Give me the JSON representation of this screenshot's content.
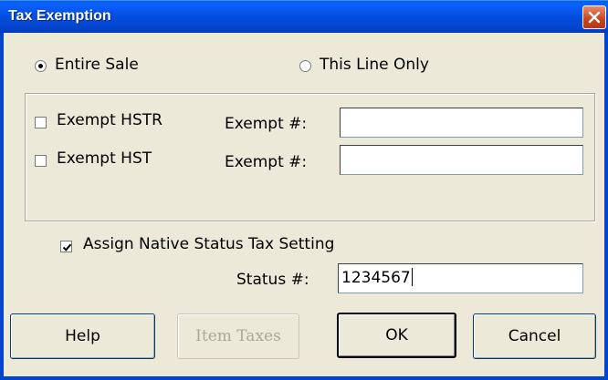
{
  "window": {
    "title": "Tax Exemption"
  },
  "scope": {
    "options": [
      {
        "label": "Entire Sale",
        "selected": true
      },
      {
        "label": "This Line Only",
        "selected": false
      }
    ]
  },
  "exemptions": [
    {
      "label": "Exempt HSTR",
      "checked": false,
      "number_label": "Exempt #:",
      "value": ""
    },
    {
      "label": "Exempt HST",
      "checked": false,
      "number_label": "Exempt #:",
      "value": ""
    }
  ],
  "native_status": {
    "label": "Assign Native Status Tax Setting",
    "checked": true,
    "number_label": "Status #:",
    "value": "1234567"
  },
  "buttons": {
    "help": "Help",
    "item_taxes": "Item Taxes",
    "ok": "OK",
    "cancel": "Cancel"
  }
}
